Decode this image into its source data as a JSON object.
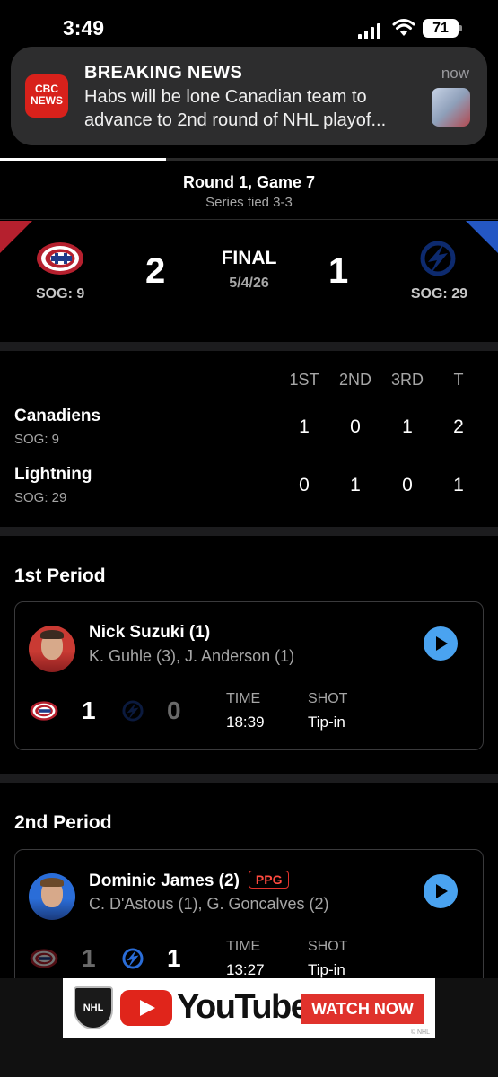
{
  "status_bar": {
    "time": "3:49",
    "battery": "71"
  },
  "notification": {
    "app_icon": "CBC NEWS",
    "title": "BREAKING NEWS",
    "time": "now",
    "body_line1": "Habs will be lone Canadian team to",
    "body_line2": "advance to 2nd round of NHL playof..."
  },
  "game": {
    "round": "Round 1, Game 7",
    "series": "Series tied 3-3",
    "status": "FINAL",
    "date": "5/4/26",
    "home": {
      "name": "Canadiens",
      "score": "2",
      "sog": "SOG: 9",
      "color": "#b5202e"
    },
    "away": {
      "name": "Lightning",
      "score": "1",
      "sog": "SOG: 29",
      "color": "#2457c4"
    }
  },
  "linescore": {
    "headers": [
      "1ST",
      "2ND",
      "3RD",
      "T"
    ],
    "rows": [
      {
        "team": "Canadiens",
        "sog": "SOG: 9",
        "cells": [
          "1",
          "0",
          "1",
          "2"
        ]
      },
      {
        "team": "Lightning",
        "sog": "SOG: 29",
        "cells": [
          "0",
          "1",
          "0",
          "1"
        ]
      }
    ]
  },
  "periods": [
    {
      "title": "1st Period",
      "goal": {
        "scorer": "Nick Suzuki (1)",
        "assists": "K. Guhle (3), J. Anderson (1)",
        "home_score": "1",
        "away_score": "0",
        "time_label": "TIME",
        "time": "18:39",
        "shot_label": "SHOT",
        "shot": "Tip-in"
      }
    },
    {
      "title": "2nd Period",
      "goal": {
        "scorer": "Dominic James (2)",
        "badge": "PPG",
        "assists": "C. D'Astous (1), G. Goncalves (2)",
        "home_score": "1",
        "away_score": "1",
        "time_label": "TIME",
        "time": "13:27",
        "shot_label": "SHOT",
        "shot": "Tip-in"
      }
    }
  ],
  "ad": {
    "brand": "YouTube",
    "cta": "WATCH NOW",
    "league": "NHL",
    "small": "© NHL"
  },
  "icons": [
    "cellular-signal-icon",
    "wifi-icon",
    "battery-icon",
    "canadiens-logo-icon",
    "lightning-logo-icon",
    "play-icon",
    "nhl-shield-icon",
    "youtube-play-icon"
  ]
}
